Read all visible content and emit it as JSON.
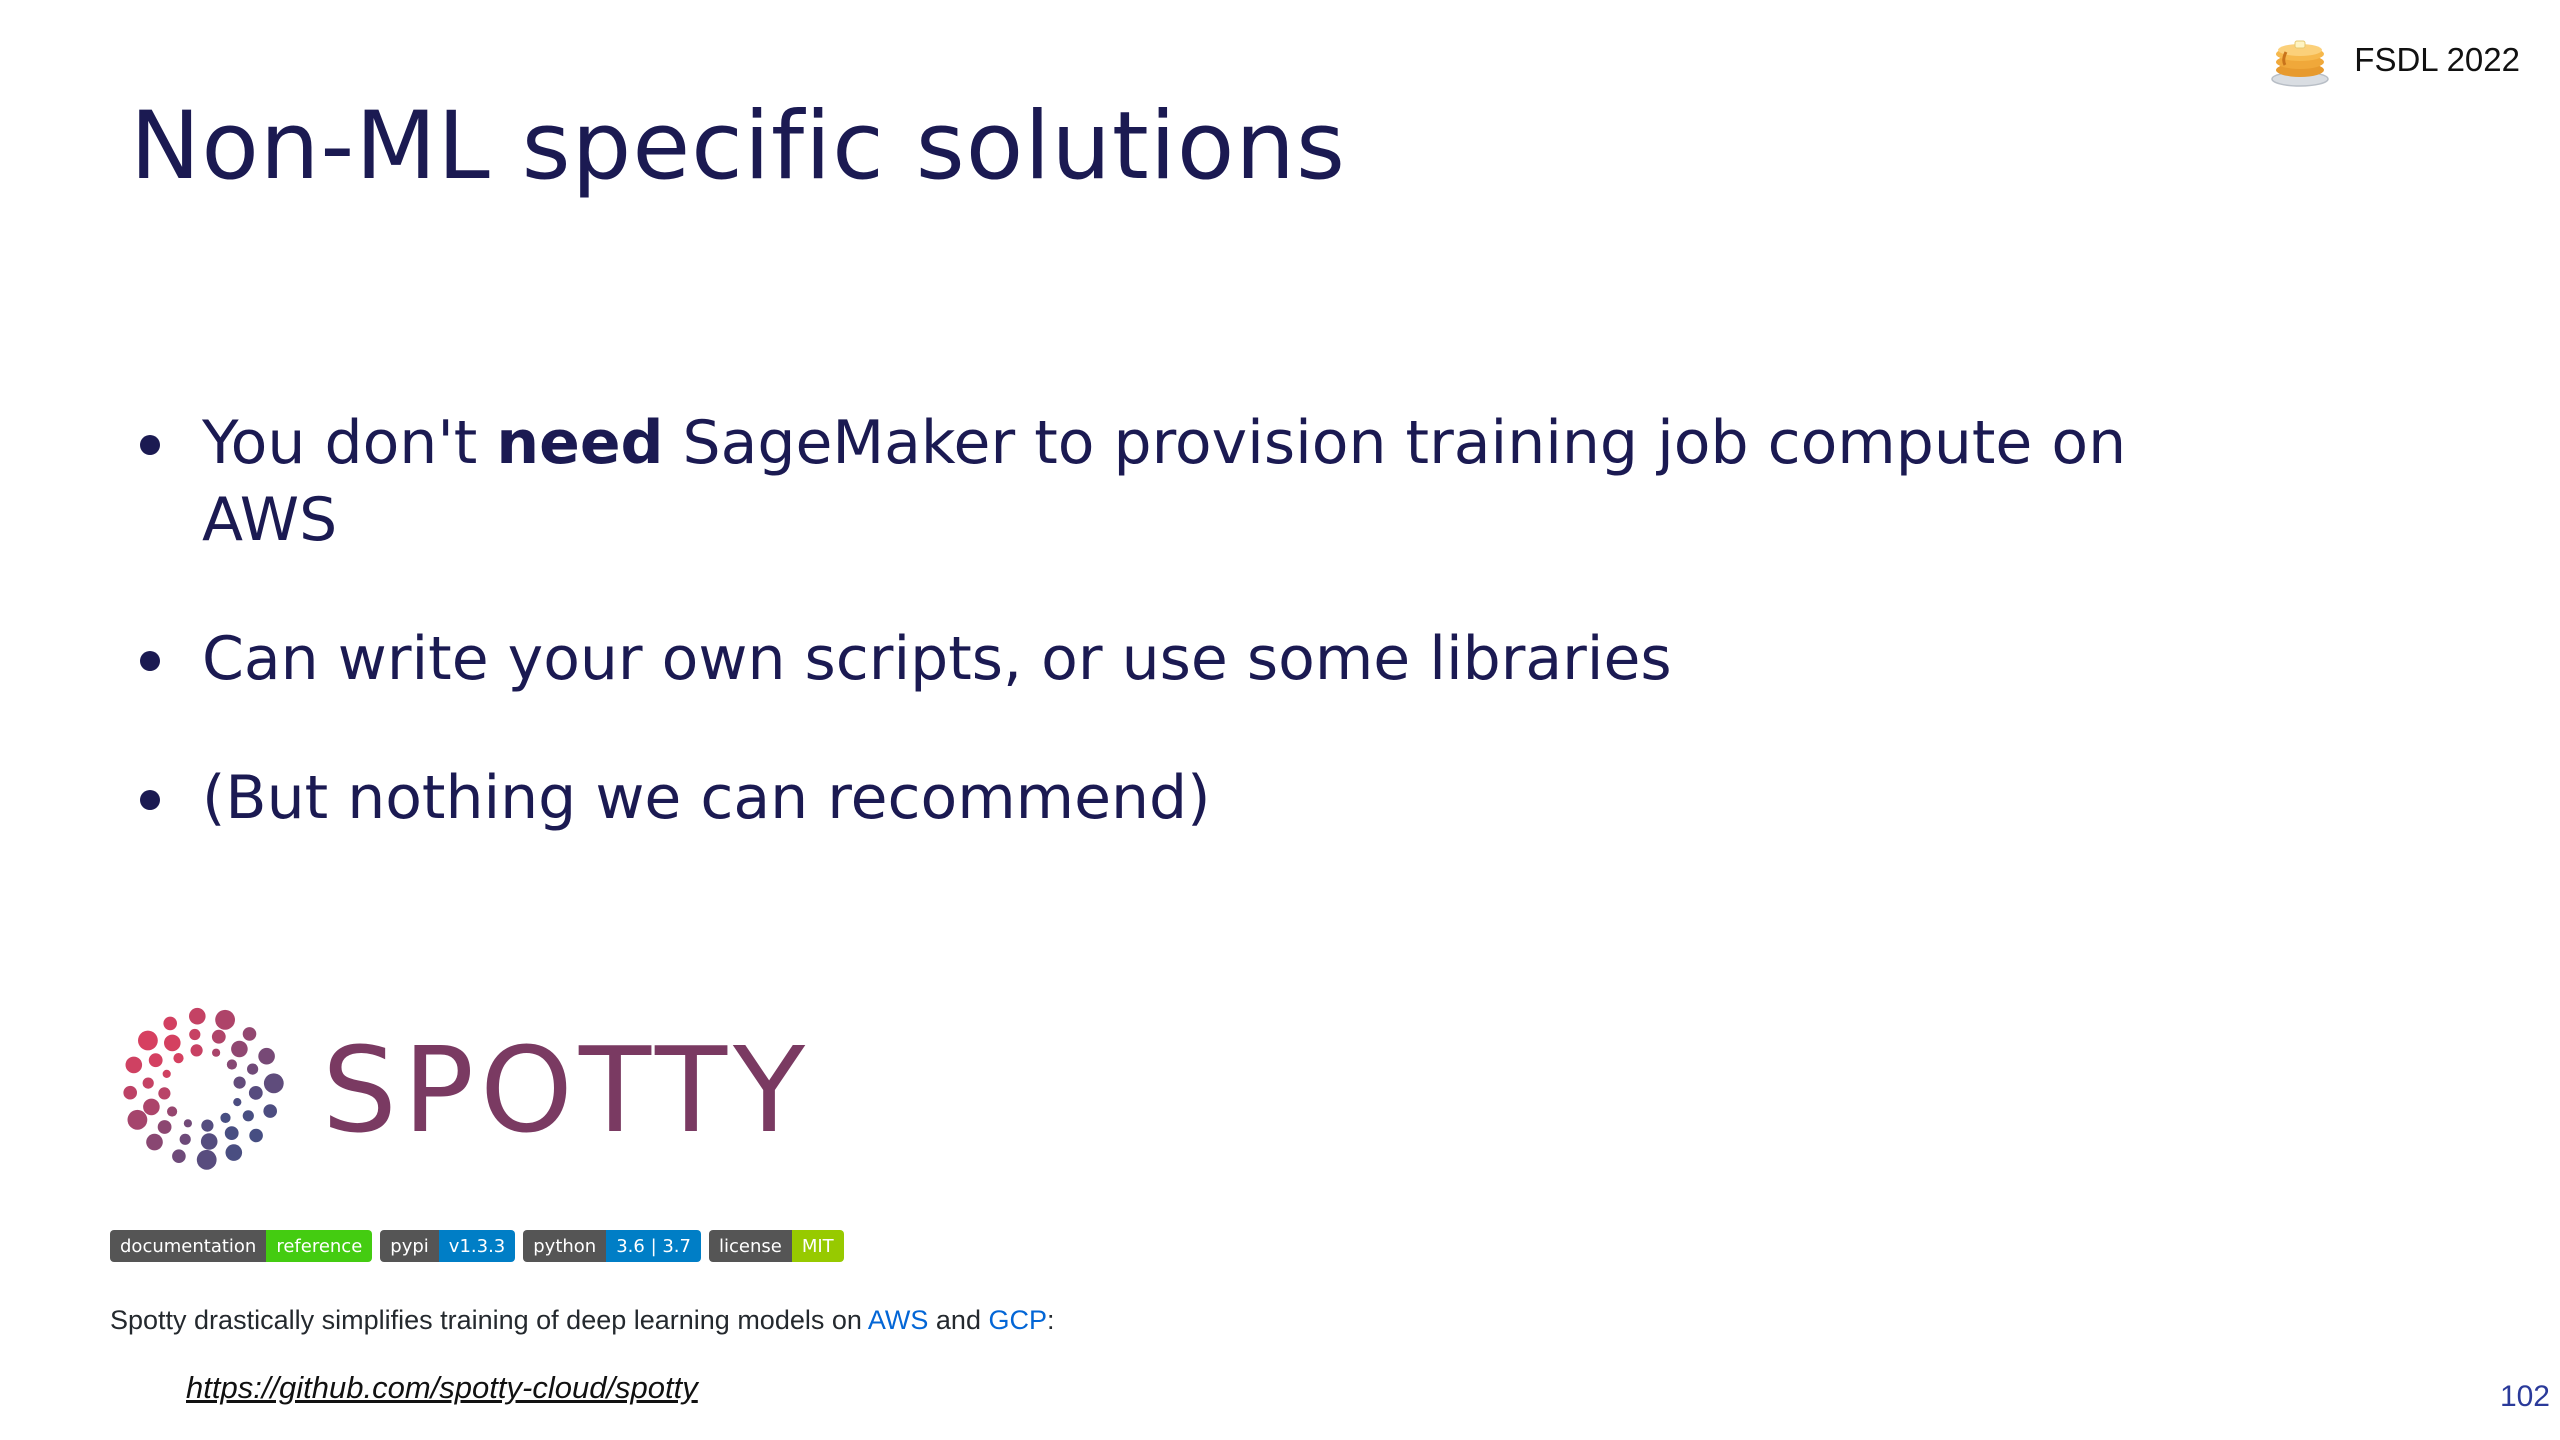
{
  "header": {
    "brand_text": "FSDL 2022",
    "brand_icon": "pancake-stack-icon"
  },
  "title": "Non-ML specific solutions",
  "bullets": [
    {
      "pre": "You don't ",
      "bold": "need",
      "post": " SageMaker to provision training job compute on AWS"
    },
    {
      "text": "Can write your own scripts, or use some libraries"
    },
    {
      "text": "(But nothing we can recommend)"
    }
  ],
  "spotty": {
    "logo_text": "SPOTTY",
    "badges": [
      {
        "label": "documentation",
        "value": "reference",
        "color": "#44cc11"
      },
      {
        "label": "pypi",
        "value": "v1.3.3",
        "color": "#007ec6"
      },
      {
        "label": "python",
        "value": "3.6 | 3.7",
        "color": "#007ec6"
      },
      {
        "label": "license",
        "value": "MIT",
        "color": "#97ca00"
      }
    ],
    "description": {
      "pre": "Spotty drastically simplifies training of deep learning models on ",
      "link1": "AWS",
      "mid": " and ",
      "link2": "GCP",
      "post": ":"
    },
    "url": "https://github.com/spotty-cloud/spotty"
  },
  "page_number": "102"
}
